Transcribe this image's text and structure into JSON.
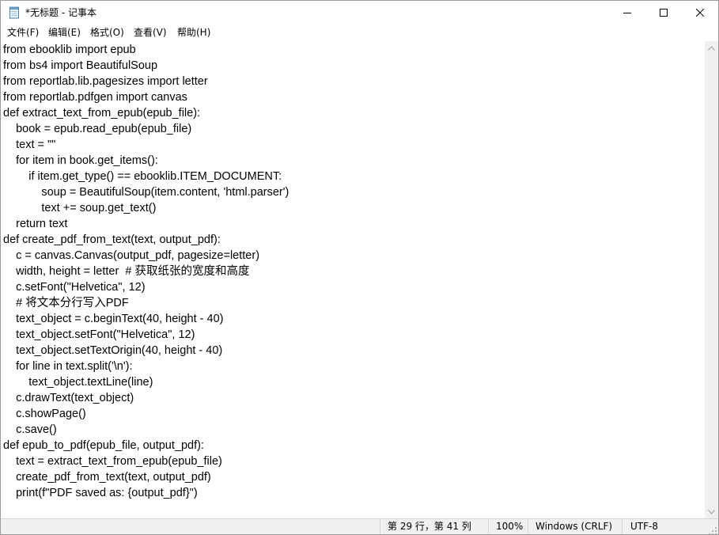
{
  "window": {
    "title": "*无标题 - 记事本"
  },
  "menu": [
    {
      "label": "文件(F)"
    },
    {
      "label": "编辑(E)"
    },
    {
      "label": "格式(O)"
    },
    {
      "label": "查看(V)"
    },
    {
      "label": "帮助(H)"
    }
  ],
  "editor": {
    "lines": [
      "from ebooklib import epub",
      "from bs4 import BeautifulSoup",
      "from reportlab.lib.pagesizes import letter",
      "from reportlab.pdfgen import canvas",
      "def extract_text_from_epub(epub_file):",
      "    book = epub.read_epub(epub_file)",
      "    text = \"\"",
      "    for item in book.get_items():",
      "        if item.get_type() == ebooklib.ITEM_DOCUMENT:",
      "            soup = BeautifulSoup(item.content, 'html.parser')",
      "            text += soup.get_text()",
      "    return text",
      "def create_pdf_from_text(text, output_pdf):",
      "    c = canvas.Canvas(output_pdf, pagesize=letter)",
      "    width, height = letter  # 获取纸张的宽度和高度",
      "    c.setFont(\"Helvetica\", 12)",
      "    # 将文本分行写入PDF",
      "    text_object = c.beginText(40, height - 40)",
      "    text_object.setFont(\"Helvetica\", 12)",
      "    text_object.setTextOrigin(40, height - 40)",
      "    for line in text.split('\\n'):",
      "        text_object.textLine(line)",
      "    c.drawText(text_object)",
      "    c.showPage()",
      "    c.save()",
      "def epub_to_pdf(epub_file, output_pdf):",
      "    text = extract_text_from_epub(epub_file)",
      "    create_pdf_from_text(text, output_pdf)",
      "    print(f\"PDF saved as: {output_pdf}\")"
    ]
  },
  "status": {
    "position": "第 29 行，第 41 列",
    "zoom": "100%",
    "line_ending": "Windows (CRLF)",
    "encoding": "UTF-8"
  },
  "icons": {
    "app": "notepad-icon",
    "minimize": "minimize-icon",
    "maximize": "maximize-icon",
    "close": "close-icon"
  }
}
